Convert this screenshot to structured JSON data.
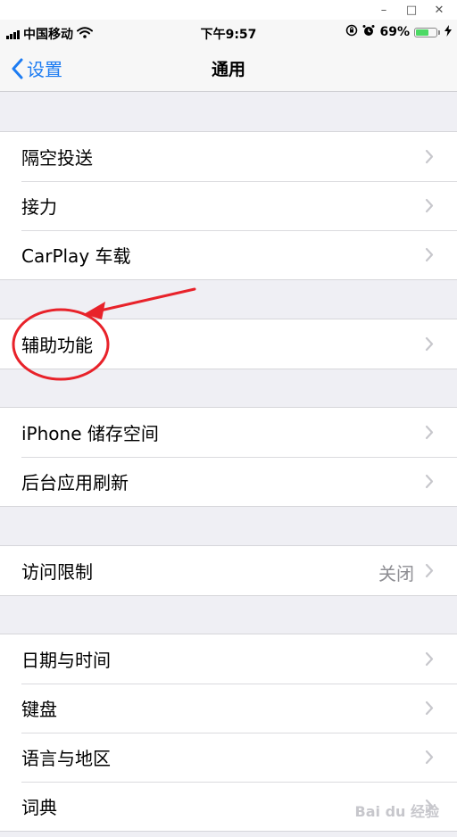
{
  "window": {
    "minimize": "–",
    "maximize": "□",
    "close": "✕"
  },
  "status": {
    "carrier": "中国移动",
    "time": "下午9:57",
    "battery_percent": "69%",
    "battery_level": 0.69
  },
  "nav": {
    "back_label": "设置",
    "title": "通用"
  },
  "groups": [
    {
      "items": [
        {
          "label": "隔空投送"
        },
        {
          "label": "接力"
        },
        {
          "label": "CarPlay 车载"
        }
      ]
    },
    {
      "items": [
        {
          "label": "辅助功能"
        }
      ]
    },
    {
      "items": [
        {
          "label": "iPhone 储存空间"
        },
        {
          "label": "后台应用刷新"
        }
      ]
    },
    {
      "items": [
        {
          "label": "访问限制",
          "value": "关闭"
        }
      ]
    },
    {
      "items": [
        {
          "label": "日期与时间"
        },
        {
          "label": "键盘"
        },
        {
          "label": "语言与地区"
        },
        {
          "label": "词典"
        }
      ]
    }
  ],
  "watermark": "Bai du 经验",
  "colors": {
    "accent": "#1d7cf2",
    "annotation": "#e8222a"
  },
  "icons": [
    "wifi-icon",
    "orientation-lock-icon",
    "alarm-icon",
    "battery-icon",
    "charging-icon",
    "chevron-left-icon",
    "chevron-right-icon"
  ]
}
